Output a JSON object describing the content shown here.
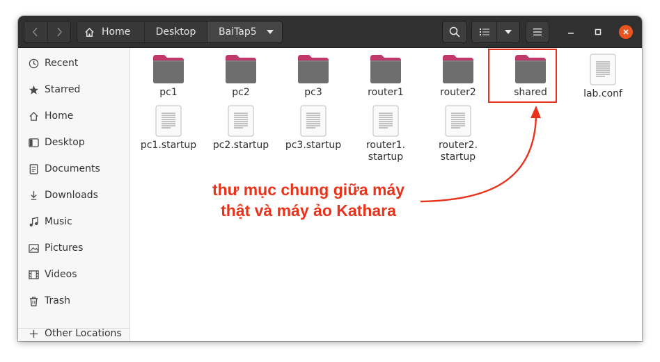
{
  "colors": {
    "accent": "#e95420",
    "annotation": "#e8331c",
    "headerbar": "#303030",
    "folder_top": "#c0376a",
    "folder_body": "#6e6e6e"
  },
  "nav": {
    "back_icon": "chevron-left-icon",
    "forward_icon": "chevron-right-icon"
  },
  "breadcrumb": {
    "home": "Home",
    "desktop": "Desktop",
    "current": "BaiTap5"
  },
  "sidebar": {
    "items": [
      {
        "label": "Recent",
        "icon": "clock-icon"
      },
      {
        "label": "Starred",
        "icon": "star-icon"
      },
      {
        "label": "Home",
        "icon": "home-icon"
      },
      {
        "label": "Desktop",
        "icon": "desktop-icon"
      },
      {
        "label": "Documents",
        "icon": "document-icon"
      },
      {
        "label": "Downloads",
        "icon": "download-icon"
      },
      {
        "label": "Music",
        "icon": "music-icon"
      },
      {
        "label": "Pictures",
        "icon": "picture-icon"
      },
      {
        "label": "Videos",
        "icon": "film-icon"
      },
      {
        "label": "Trash",
        "icon": "trash-icon"
      }
    ],
    "other_locations": "Other Locations"
  },
  "files": [
    {
      "name": "pc1",
      "type": "folder"
    },
    {
      "name": "pc2",
      "type": "folder"
    },
    {
      "name": "pc3",
      "type": "folder"
    },
    {
      "name": "router1",
      "type": "folder"
    },
    {
      "name": "router2",
      "type": "folder"
    },
    {
      "name": "shared",
      "type": "folder"
    },
    {
      "name": "lab.conf",
      "type": "file"
    },
    {
      "name": "pc1.startup",
      "type": "file"
    },
    {
      "name": "pc2.startup",
      "type": "file"
    },
    {
      "name": "pc3.startup",
      "type": "file"
    },
    {
      "name": "router1.\nstartup",
      "type": "file"
    },
    {
      "name": "router2.\nstartup",
      "type": "file"
    }
  ],
  "annotation": {
    "line1": "thư mục chung giữa máy",
    "line2": "thật và máy ảo Kathara"
  }
}
